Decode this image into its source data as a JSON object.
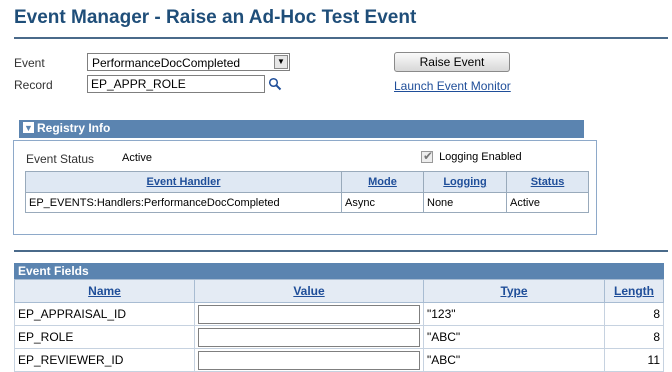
{
  "page": {
    "title": "Event Manager - Raise an Ad-Hoc Test Event"
  },
  "form": {
    "event_label": "Event",
    "event_value": "PerformanceDocCompleted",
    "record_label": "Record",
    "record_value": "EP_APPR_ROLE",
    "raise_button": "Raise Event",
    "monitor_link": "Launch Event Monitor"
  },
  "registry": {
    "header": "Registry Info",
    "status_label": "Event Status",
    "status_value": "Active",
    "logging_label": "Logging Enabled",
    "logging_checked": true,
    "columns": [
      "Event Handler",
      "Mode",
      "Logging",
      "Status"
    ],
    "rows": [
      [
        "EP_EVENTS:Handlers:PerformanceDocCompleted",
        "Async",
        "None",
        "Active"
      ]
    ]
  },
  "fields": {
    "header": "Event Fields",
    "columns": [
      "Name",
      "Value",
      "Type",
      "Length"
    ],
    "rows": [
      {
        "name": "EP_APPRAISAL_ID",
        "value": "",
        "type": "\"123\"",
        "length": "8"
      },
      {
        "name": "EP_ROLE",
        "value": "",
        "type": "\"ABC\"",
        "length": "8"
      },
      {
        "name": "EP_REVIEWER_ID",
        "value": "",
        "type": "\"ABC\"",
        "length": "11"
      }
    ]
  }
}
